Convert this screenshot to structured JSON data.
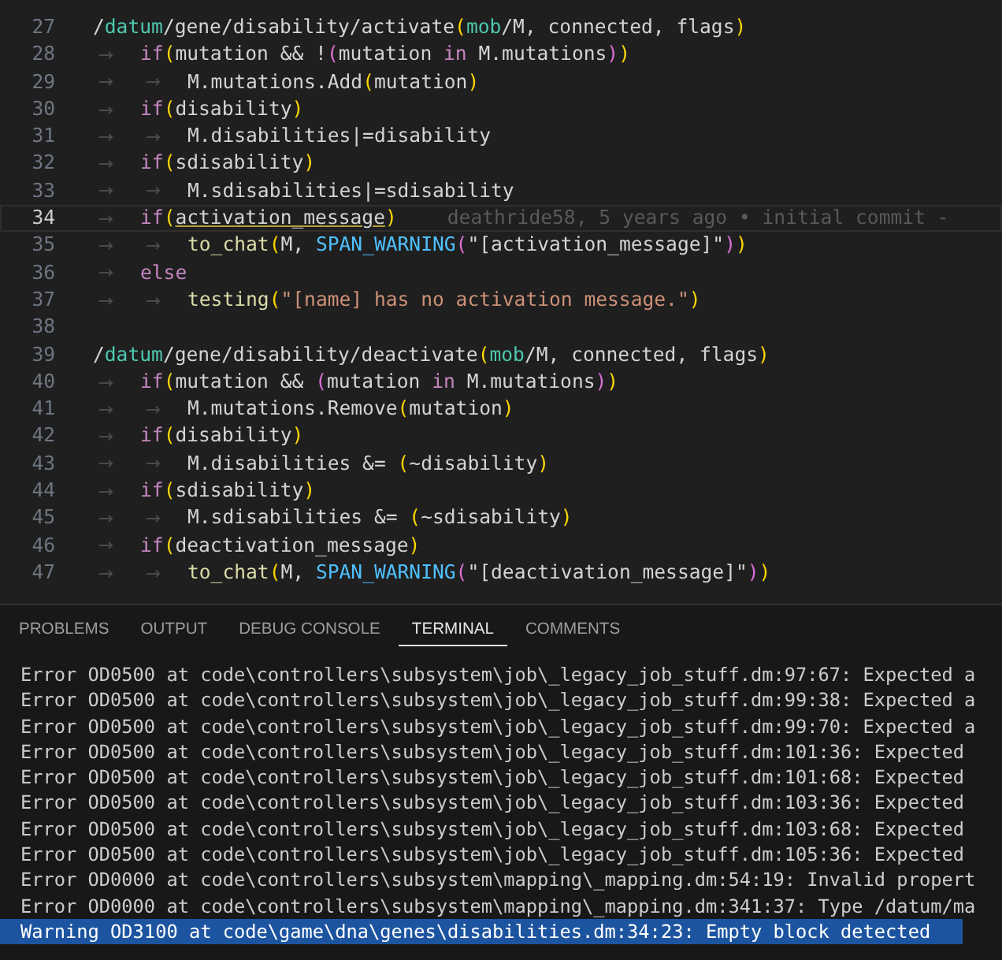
{
  "editor": {
    "lines": [
      {
        "number": "27",
        "current": false,
        "tokens": [
          {
            "text": "/",
            "kind": "plain"
          },
          {
            "text": "datum",
            "kind": "type"
          },
          {
            "text": "/gene/disability/activate",
            "kind": "plain"
          },
          {
            "text": "(",
            "kind": "paren"
          },
          {
            "text": "mob",
            "kind": "type"
          },
          {
            "text": "/M, connected, flags",
            "kind": "plain"
          },
          {
            "text": ")",
            "kind": "paren"
          }
        ],
        "children": [
          {
            "number": "28",
            "current": false,
            "tokens": [
              {
                "text": "if",
                "kind": "keyword"
              },
              {
                "text": "(",
                "kind": "paren"
              },
              {
                "text": "mutation && !",
                "kind": "plain"
              },
              {
                "text": "(",
                "kind": "paren2"
              },
              {
                "text": "mutation ",
                "kind": "plain"
              },
              {
                "text": "in",
                "kind": "keyword"
              },
              {
                "text": " M.mutations",
                "kind": "plain"
              },
              {
                "text": ")",
                "kind": "paren2"
              },
              {
                "text": ")",
                "kind": "paren"
              }
            ],
            "children": [
              {
                "number": "29",
                "current": false,
                "tokens": [
                  {
                    "text": "M.mutations.Add",
                    "kind": "plain"
                  },
                  {
                    "text": "(",
                    "kind": "paren"
                  },
                  {
                    "text": "mutation",
                    "kind": "plain"
                  },
                  {
                    "text": ")",
                    "kind": "paren"
                  }
                ]
              }
            ]
          },
          {
            "number": "30",
            "current": false,
            "tokens": [
              {
                "text": "if",
                "kind": "keyword"
              },
              {
                "text": "(",
                "kind": "paren"
              },
              {
                "text": "disability",
                "kind": "plain"
              },
              {
                "text": ")",
                "kind": "paren"
              }
            ],
            "children": [
              {
                "number": "31",
                "current": false,
                "tokens": [
                  {
                    "text": "M.disabilities|=disability",
                    "kind": "plain"
                  }
                ]
              }
            ]
          },
          {
            "number": "32",
            "current": false,
            "tokens": [
              {
                "text": "if",
                "kind": "keyword"
              },
              {
                "text": "(",
                "kind": "paren"
              },
              {
                "text": "sdisability",
                "kind": "plain"
              },
              {
                "text": ")",
                "kind": "paren"
              }
            ],
            "children": [
              {
                "number": "33",
                "current": false,
                "tokens": [
                  {
                    "text": "M.sdisabilities|=sdisability",
                    "kind": "plain"
                  }
                ]
              }
            ]
          },
          {
            "number": "34",
            "current": true,
            "blame": "deathride58, 5 years ago • initial commit -",
            "tokens": [
              {
                "text": "if",
                "kind": "keyword"
              },
              {
                "text": "(",
                "kind": "paren"
              },
              {
                "text": "activation_message",
                "kind": "matched"
              },
              {
                "text": ")",
                "kind": "paren"
              }
            ],
            "children": [
              {
                "number": "35",
                "current": false,
                "tokens": [
                  {
                    "text": "to_chat",
                    "kind": "func"
                  },
                  {
                    "text": "(",
                    "kind": "paren"
                  },
                  {
                    "text": "M, ",
                    "kind": "plain"
                  },
                  {
                    "text": "SPAN_WARNING",
                    "kind": "const"
                  },
                  {
                    "text": "(",
                    "kind": "paren2"
                  },
                  {
                    "text": "\"[activation_message]\"",
                    "kind": "plain"
                  },
                  {
                    "text": ")",
                    "kind": "paren2"
                  },
                  {
                    "text": ")",
                    "kind": "paren"
                  }
                ]
              }
            ]
          },
          {
            "number": "36",
            "current": false,
            "tokens": [
              {
                "text": "else",
                "kind": "keyword"
              }
            ],
            "children": [
              {
                "number": "37",
                "current": false,
                "tokens": [
                  {
                    "text": "testing",
                    "kind": "func"
                  },
                  {
                    "text": "(",
                    "kind": "paren"
                  },
                  {
                    "text": "\"[name] has no activation message.\"",
                    "kind": "string"
                  },
                  {
                    "text": ")",
                    "kind": "paren"
                  }
                ]
              }
            ]
          }
        ]
      },
      {
        "number": "38",
        "current": false
      },
      {
        "number": "39",
        "current": false,
        "tokens": [
          {
            "text": "/",
            "kind": "plain"
          },
          {
            "text": "datum",
            "kind": "type"
          },
          {
            "text": "/gene/disability/deactivate",
            "kind": "plain"
          },
          {
            "text": "(",
            "kind": "paren"
          },
          {
            "text": "mob",
            "kind": "type"
          },
          {
            "text": "/M, connected, flags",
            "kind": "plain"
          },
          {
            "text": ")",
            "kind": "paren"
          }
        ],
        "children": [
          {
            "number": "40",
            "current": false,
            "tokens": [
              {
                "text": "if",
                "kind": "keyword"
              },
              {
                "text": "(",
                "kind": "paren"
              },
              {
                "text": "mutation && ",
                "kind": "plain"
              },
              {
                "text": "(",
                "kind": "paren2"
              },
              {
                "text": "mutation ",
                "kind": "plain"
              },
              {
                "text": "in",
                "kind": "keyword"
              },
              {
                "text": " M.mutations",
                "kind": "plain"
              },
              {
                "text": ")",
                "kind": "paren2"
              },
              {
                "text": ")",
                "kind": "paren"
              }
            ],
            "children": [
              {
                "number": "41",
                "current": false,
                "tokens": [
                  {
                    "text": "M.mutations.Remove",
                    "kind": "plain"
                  },
                  {
                    "text": "(",
                    "kind": "paren"
                  },
                  {
                    "text": "mutation",
                    "kind": "plain"
                  },
                  {
                    "text": ")",
                    "kind": "paren"
                  }
                ]
              }
            ]
          },
          {
            "number": "42",
            "current": false,
            "tokens": [
              {
                "text": "if",
                "kind": "keyword"
              },
              {
                "text": "(",
                "kind": "paren"
              },
              {
                "text": "disability",
                "kind": "plain"
              },
              {
                "text": ")",
                "kind": "paren"
              }
            ],
            "children": [
              {
                "number": "43",
                "current": false,
                "tokens": [
                  {
                    "text": "M.disabilities &= ",
                    "kind": "plain"
                  },
                  {
                    "text": "(",
                    "kind": "paren"
                  },
                  {
                    "text": "~disability",
                    "kind": "plain"
                  },
                  {
                    "text": ")",
                    "kind": "paren"
                  }
                ]
              }
            ]
          },
          {
            "number": "44",
            "current": false,
            "tokens": [
              {
                "text": "if",
                "kind": "keyword"
              },
              {
                "text": "(",
                "kind": "paren"
              },
              {
                "text": "sdisability",
                "kind": "plain"
              },
              {
                "text": ")",
                "kind": "paren"
              }
            ],
            "children": [
              {
                "number": "45",
                "current": false,
                "tokens": [
                  {
                    "text": "M.sdisabilities &= ",
                    "kind": "plain"
                  },
                  {
                    "text": "(",
                    "kind": "paren"
                  },
                  {
                    "text": "~sdisability",
                    "kind": "plain"
                  },
                  {
                    "text": ")",
                    "kind": "paren"
                  }
                ]
              }
            ]
          },
          {
            "number": "46",
            "current": false,
            "tokens": [
              {
                "text": "if",
                "kind": "keyword"
              },
              {
                "text": "(",
                "kind": "paren"
              },
              {
                "text": "deactivation_message",
                "kind": "plain"
              },
              {
                "text": ")",
                "kind": "paren"
              }
            ],
            "children": [
              {
                "number": "47",
                "current": false,
                "tokens": [
                  {
                    "text": "to_chat",
                    "kind": "func"
                  },
                  {
                    "text": "(",
                    "kind": "paren"
                  },
                  {
                    "text": "M, ",
                    "kind": "plain"
                  },
                  {
                    "text": "SPAN_WARNING",
                    "kind": "const"
                  },
                  {
                    "text": "(",
                    "kind": "paren2"
                  },
                  {
                    "text": "\"[deactivation_message]\"",
                    "kind": "plain"
                  },
                  {
                    "text": ")",
                    "kind": "paren2"
                  },
                  {
                    "text": ")",
                    "kind": "paren"
                  }
                ]
              }
            ]
          }
        ]
      }
    ]
  },
  "panel": {
    "tabs": [
      {
        "label": "PROBLEMS",
        "selected": false
      },
      {
        "label": "OUTPUT",
        "selected": false
      },
      {
        "label": "DEBUG CONSOLE",
        "selected": false
      },
      {
        "label": "TERMINAL",
        "selected": true
      },
      {
        "label": "COMMENTS",
        "selected": false
      }
    ],
    "terminal_lines": [
      {
        "text": "Error OD0500 at code\\controllers\\subsystem\\job\\_legacy_job_stuff.dm:97:67: Expected a",
        "selected": false
      },
      {
        "text": "Error OD0500 at code\\controllers\\subsystem\\job\\_legacy_job_stuff.dm:99:38: Expected a",
        "selected": false
      },
      {
        "text": "Error OD0500 at code\\controllers\\subsystem\\job\\_legacy_job_stuff.dm:99:70: Expected a",
        "selected": false
      },
      {
        "text": "Error OD0500 at code\\controllers\\subsystem\\job\\_legacy_job_stuff.dm:101:36: Expected",
        "selected": false
      },
      {
        "text": "Error OD0500 at code\\controllers\\subsystem\\job\\_legacy_job_stuff.dm:101:68: Expected",
        "selected": false
      },
      {
        "text": "Error OD0500 at code\\controllers\\subsystem\\job\\_legacy_job_stuff.dm:103:36: Expected",
        "selected": false
      },
      {
        "text": "Error OD0500 at code\\controllers\\subsystem\\job\\_legacy_job_stuff.dm:103:68: Expected",
        "selected": false
      },
      {
        "text": "Error OD0500 at code\\controllers\\subsystem\\job\\_legacy_job_stuff.dm:105:36: Expected",
        "selected": false
      },
      {
        "text": "Error OD0000 at code\\controllers\\subsystem\\mapping\\_mapping.dm:54:19: Invalid propert",
        "selected": false
      },
      {
        "text": "Error OD0000 at code\\controllers\\subsystem\\mapping\\_mapping.dm:341:37: Type /datum/ma",
        "selected": false
      },
      {
        "text": "Warning OD3100 at code\\game\\dna\\genes\\disabilities.dm:34:23: Empty block detected",
        "selected": true
      }
    ]
  }
}
